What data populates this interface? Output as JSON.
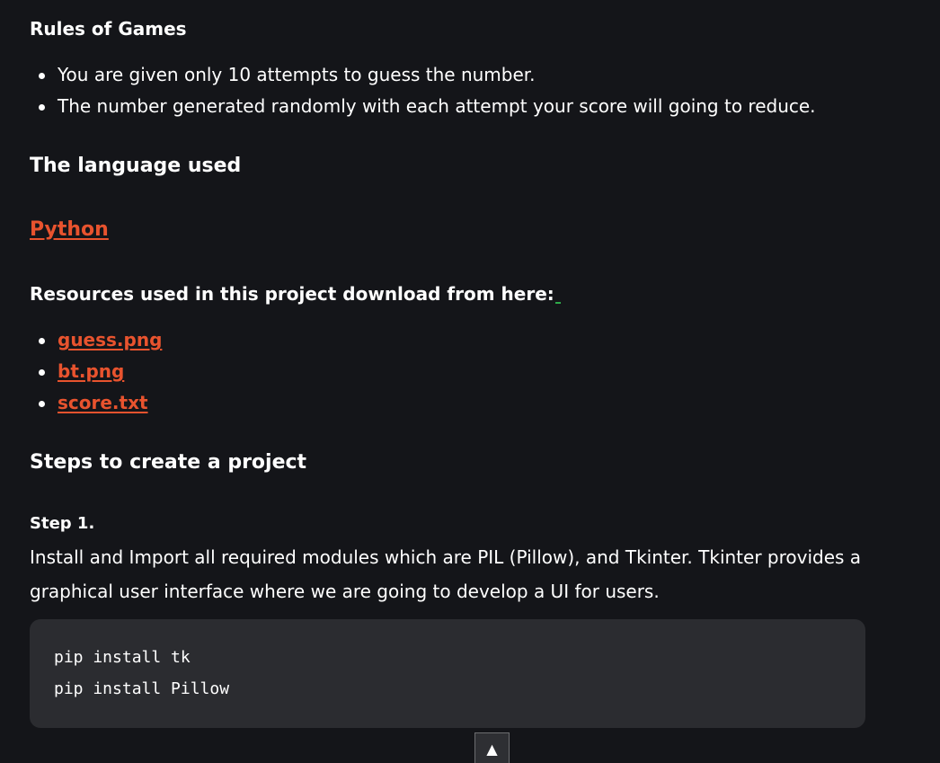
{
  "rules": {
    "heading": "Rules of Games",
    "items": [
      "You are given only 10 attempts to guess the number.",
      "The number generated randomly with each attempt your score will going to reduce."
    ]
  },
  "language": {
    "heading": "The language used",
    "link_label": "Python"
  },
  "resources": {
    "heading": "Resources used in this project download from here:",
    "files": [
      "guess.png",
      "bt.png",
      "score.txt"
    ]
  },
  "steps": {
    "heading": "Steps to create a project",
    "step1_title": "Step 1.",
    "step1_body": " Install and Import all required modules which are PIL (Pillow), and Tkinter. Tkinter provides a graphical user interface where we are going to develop a UI for users.",
    "code_lines": [
      "pip install tk",
      "pip install Pillow"
    ]
  },
  "scroll_top_glyph": "▲",
  "colors": {
    "background": "#141519",
    "link": "#e8532e",
    "code_background": "#2b2c30"
  }
}
